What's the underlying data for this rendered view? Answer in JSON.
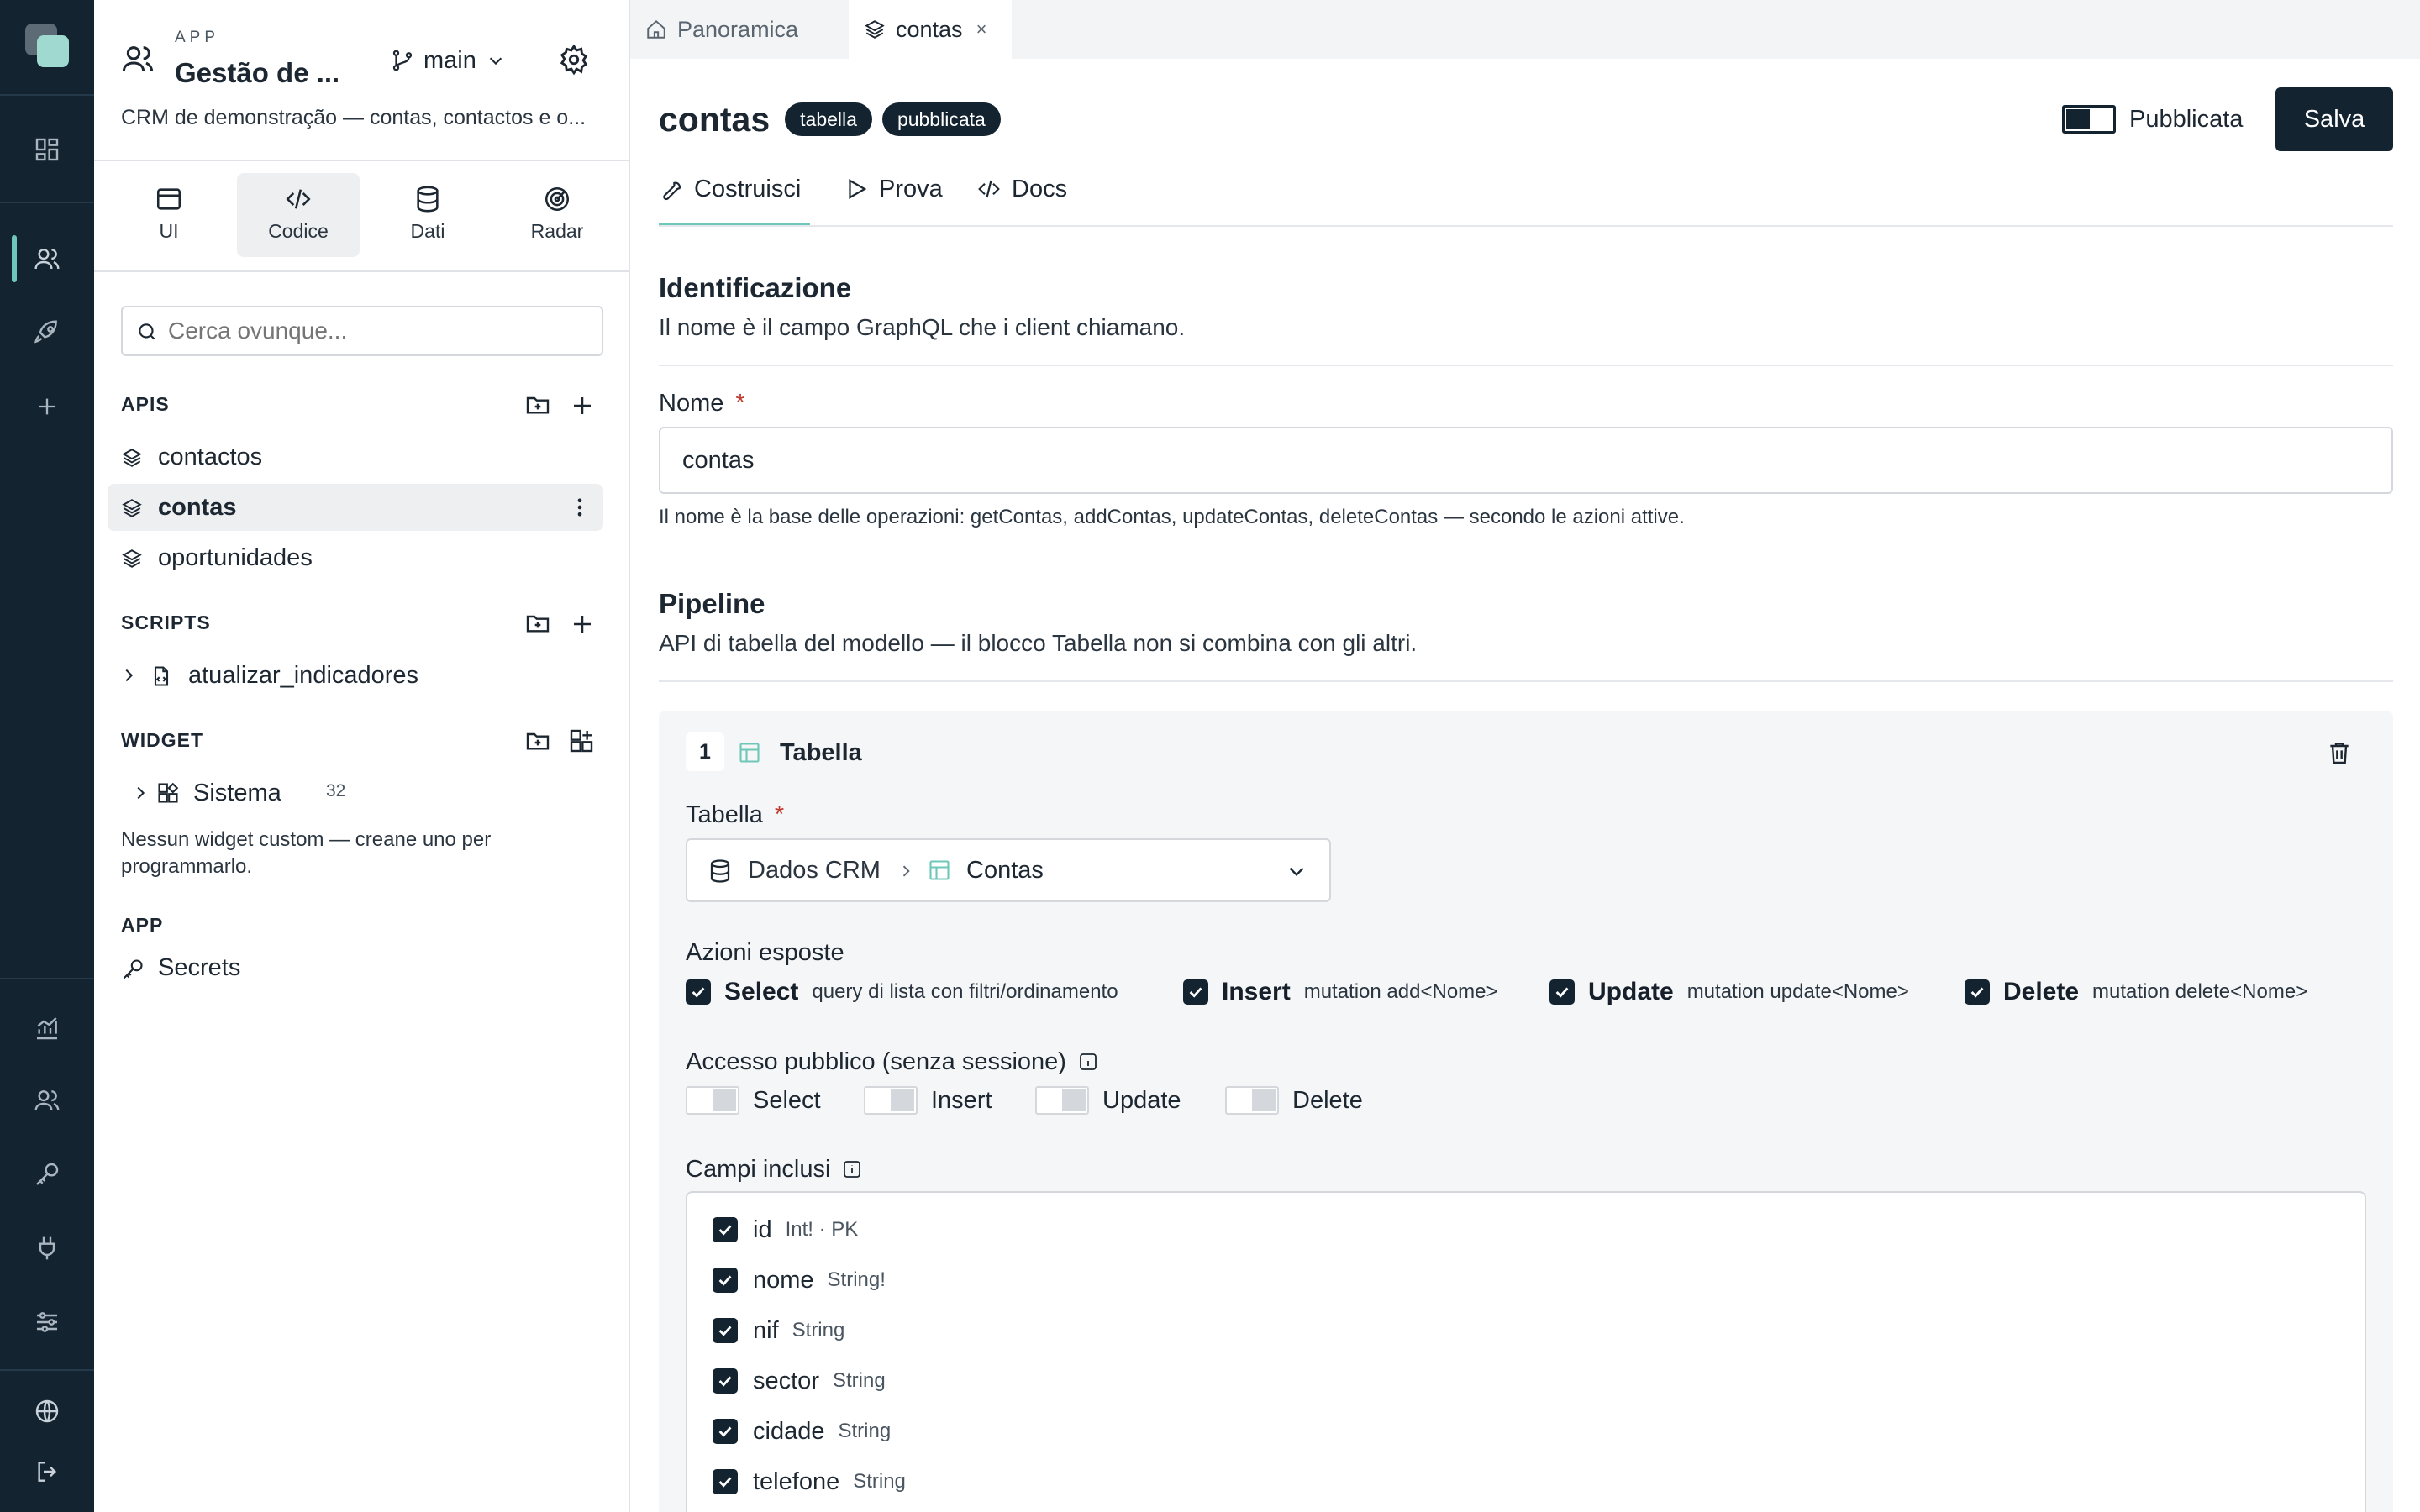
{
  "app": {
    "caption": "APP",
    "name": "Gestão de ...",
    "branch": "main",
    "description": "CRM de demonstração — contas, contactos e o..."
  },
  "rail": {
    "icons": [
      "app-logo-icon",
      "dashboard-icon",
      "users-icon",
      "rocket-icon",
      "plus-icon",
      "chart-icon",
      "users-icon",
      "key-icon",
      "plug-icon",
      "sliders-icon",
      "globe-icon",
      "logout-icon"
    ]
  },
  "modes": {
    "ui": "UI",
    "code": "Codice",
    "data": "Dati",
    "radar": "Radar"
  },
  "search": {
    "placeholder": "Cerca ovunque..."
  },
  "apis": {
    "heading": "APIS",
    "items": [
      {
        "label": "contactos"
      },
      {
        "label": "contas"
      },
      {
        "label": "oportunidades"
      }
    ]
  },
  "scripts": {
    "heading": "SCRIPTS",
    "items": [
      {
        "label": "atualizar_indicadores"
      }
    ]
  },
  "widget": {
    "heading": "WIDGET",
    "group_label": "Sistema",
    "group_count": "32",
    "empty_line1": "Nessun widget custom — creane uno per",
    "empty_line2": "programmarlo."
  },
  "app_section": {
    "heading": "APP",
    "secrets": "Secrets"
  },
  "tabs": {
    "overview": "Panoramica",
    "current": "contas",
    "close": "×"
  },
  "header": {
    "title": "contas",
    "badge_type": "tabella",
    "badge_status": "pubblicata",
    "publish_label": "Pubblicata",
    "save": "Salva"
  },
  "subtabs": {
    "build": "Costruisci",
    "test": "Prova",
    "docs": "Docs"
  },
  "identification": {
    "title": "Identificazione",
    "subtitle": "Il nome è il campo GraphQL che i client chiamano.",
    "name_label": "Nome",
    "required": "*",
    "name_value": "contas",
    "hint": "Il nome è la base delle operazioni: getContas, addContas, updateContas, deleteContas — secondo le azioni attive."
  },
  "pipeline": {
    "title": "Pipeline",
    "subtitle": "API di tabella del modello — il blocco Tabella non si combina con gli altri.",
    "block_number": "1",
    "block_title": "Tabella",
    "table_label": "Tabella",
    "table_db": "Dados CRM",
    "table_name": "Contas",
    "actions_label": "Azioni esposte",
    "actions": [
      {
        "name": "Select",
        "desc": "query di lista con filtri/ordinamento"
      },
      {
        "name": "Insert",
        "desc": "mutation add<Nome>"
      },
      {
        "name": "Update",
        "desc": "mutation update<Nome>"
      },
      {
        "name": "Delete",
        "desc": "mutation delete<Nome>"
      }
    ],
    "public_label": "Accesso pubblico (senza sessione)",
    "public_actions": [
      "Select",
      "Insert",
      "Update",
      "Delete"
    ],
    "fields_label": "Campi inclusi",
    "fields": [
      {
        "name": "id",
        "type": "Int! · PK"
      },
      {
        "name": "nome",
        "type": "String!"
      },
      {
        "name": "nif",
        "type": "String"
      },
      {
        "name": "sector",
        "type": "String"
      },
      {
        "name": "cidade",
        "type": "String"
      },
      {
        "name": "telefone",
        "type": "String"
      }
    ]
  },
  "colors": {
    "rail": "#132430",
    "accent": "#6ec7b8",
    "primary": "#132430",
    "required": "#c0392b"
  }
}
